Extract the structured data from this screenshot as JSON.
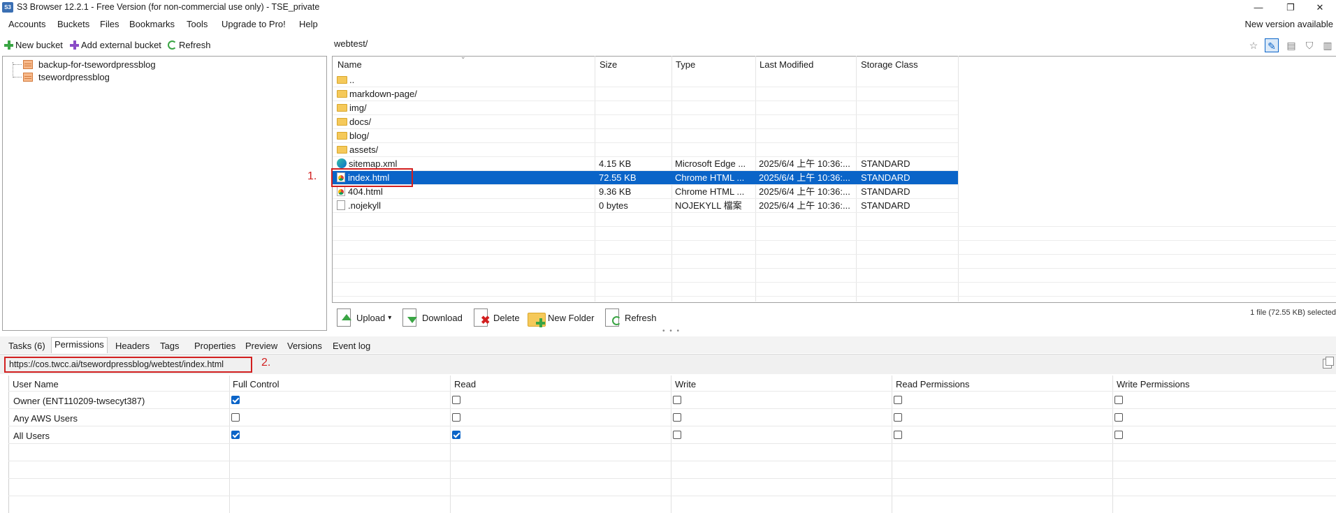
{
  "window": {
    "app_icon_text": "S3",
    "title": "S3 Browser 12.2.1 - Free Version (for non-commercial use only) - TSE_private",
    "minimize": "—",
    "maximize": "❐",
    "close": "✕"
  },
  "menu": {
    "items": [
      "Accounts",
      "Buckets",
      "Files",
      "Bookmarks",
      "Tools",
      "Upgrade to Pro!",
      "Help"
    ],
    "new_version": "New version available"
  },
  "bucket_toolbar": {
    "new_bucket": "New bucket",
    "add_external_bucket": "Add external bucket",
    "refresh": "Refresh"
  },
  "buckets": [
    "backup-for-tsewordpressblog",
    "tsewordpressblog"
  ],
  "path": "webtest/",
  "file_list": {
    "columns": [
      "Name",
      "Size",
      "Type",
      "Last Modified",
      "Storage Class"
    ],
    "rows": [
      {
        "name": "..",
        "size": "",
        "type": "",
        "modified": "",
        "storage": "",
        "icon": "folder-icon"
      },
      {
        "name": "markdown-page/",
        "size": "",
        "type": "",
        "modified": "",
        "storage": "",
        "icon": "folder-icon"
      },
      {
        "name": "img/",
        "size": "",
        "type": "",
        "modified": "",
        "storage": "",
        "icon": "folder-icon"
      },
      {
        "name": "docs/",
        "size": "",
        "type": "",
        "modified": "",
        "storage": "",
        "icon": "folder-icon"
      },
      {
        "name": "blog/",
        "size": "",
        "type": "",
        "modified": "",
        "storage": "",
        "icon": "folder-icon"
      },
      {
        "name": "assets/",
        "size": "",
        "type": "",
        "modified": "",
        "storage": "",
        "icon": "folder-icon"
      },
      {
        "name": "sitemap.xml",
        "size": "4.15 KB",
        "type": "Microsoft Edge ...",
        "modified": "2025/6/4 上午 10:36:...",
        "storage": "STANDARD",
        "icon": "edge-icon"
      },
      {
        "name": "index.html",
        "size": "72.55 KB",
        "type": "Chrome HTML ...",
        "modified": "2025/6/4 上午 10:36:...",
        "storage": "STANDARD",
        "icon": "chrome-html-icon",
        "selected": true
      },
      {
        "name": "404.html",
        "size": "9.36 KB",
        "type": "Chrome HTML ...",
        "modified": "2025/6/4 上午 10:36:...",
        "storage": "STANDARD",
        "icon": "chrome-html-icon"
      },
      {
        "name": ".nojekyll",
        "size": "0 bytes",
        "type": "NOJEKYLL 檔案",
        "modified": "2025/6/4 上午 10:36:...",
        "storage": "STANDARD",
        "icon": "file-icon"
      }
    ]
  },
  "annotations": {
    "label1": "1.",
    "label2": "2."
  },
  "file_toolbar": {
    "upload": "Upload",
    "upload_dropdown": "▾",
    "download": "Download",
    "delete": "Delete",
    "new_folder": "New Folder",
    "refresh": "Refresh",
    "status": "1 file (72.55 KB) selected"
  },
  "splitter_dots": "• • •",
  "bottom_tabs": [
    "Tasks (6)",
    "Permissions",
    "Headers",
    "Tags",
    "Properties",
    "Preview",
    "Versions",
    "Event log"
  ],
  "active_tab": "Permissions",
  "url": "https://cos.twcc.ai/tsewordpressblog/webtest/index.html",
  "permissions": {
    "columns": [
      "User Name",
      "Full Control",
      "Read",
      "Write",
      "Read Permissions",
      "Write Permissions"
    ],
    "rows": [
      {
        "user": "Owner (ENT110209-twsecyt387)",
        "full_control": true,
        "read": false,
        "write": false,
        "read_permissions": false,
        "write_permissions": false
      },
      {
        "user": "Any AWS Users",
        "full_control": false,
        "read": false,
        "write": false,
        "read_permissions": false,
        "write_permissions": false
      },
      {
        "user": "All Users",
        "full_control": true,
        "read": true,
        "write": false,
        "read_permissions": false,
        "write_permissions": false
      }
    ]
  },
  "colors": {
    "selection": "#0a64c8",
    "annotation": "#d21f1f",
    "accent_green": "#3aa544"
  }
}
